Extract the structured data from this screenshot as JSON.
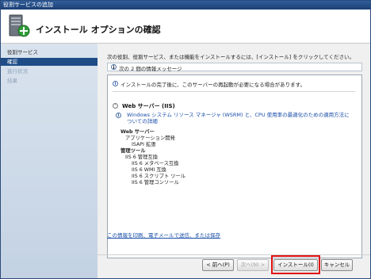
{
  "window": {
    "title": "役割サービスの追加"
  },
  "header": {
    "title": "インストール オプションの確認"
  },
  "sidebar": {
    "items": [
      {
        "label": "役割サービス"
      },
      {
        "label": "確認"
      },
      {
        "label": "進行状況"
      },
      {
        "label": "結果"
      }
    ]
  },
  "main": {
    "intro": "次の役割、役割サービス、または機能をインストールするには、[インストール] をクリックしてください。",
    "message_bar": "次の 2 個の情報メッセージ",
    "restart_notice": "インストールの完了後に、このサーバーの再起動が必要になる場合があります。",
    "section_title": "Web サーバー (IIS)",
    "warning_text": "Windows システム リソース マネージャ (WSRM) と、CPU 使用率の最適化のための適用方法についての詳細",
    "tree": [
      {
        "label": "Web サーバー",
        "bold": true
      },
      {
        "label": "アプリケーション開発",
        "bold": false
      },
      {
        "label": "ISAPI 拡張",
        "bold": false
      },
      {
        "label": "管理ツール",
        "bold": true
      },
      {
        "label": "IIS 6 管理互換",
        "bold": false
      },
      {
        "label": "IIS 6 メタベース互換",
        "bold": false
      },
      {
        "label": "IIS 6 WMI 互換",
        "bold": false
      },
      {
        "label": "IIS 6 スクリプト ツール",
        "bold": false
      },
      {
        "label": "IIS 6 管理コンソール",
        "bold": false
      }
    ],
    "print_link": "この情報を印刷、電子メールで送信、または保存"
  },
  "buttons": {
    "prev": "< 前へ(P)",
    "next": "次へ(N) >",
    "install": "インストール(I)",
    "cancel": "キャンセル"
  }
}
